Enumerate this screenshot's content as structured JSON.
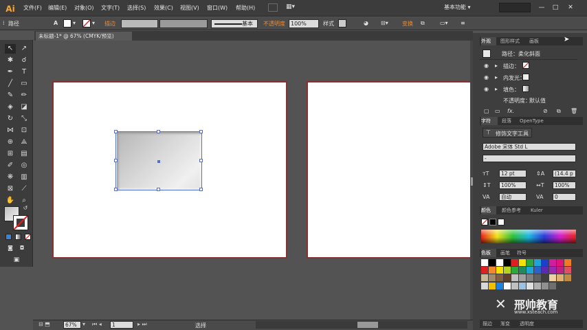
{
  "app": {
    "logo": "Ai"
  },
  "menu": [
    "文件(F)",
    "编辑(E)",
    "对象(O)",
    "文字(T)",
    "选择(S)",
    "效果(C)",
    "视图(V)",
    "窗口(W)",
    "帮助(H)"
  ],
  "workspace_label": "基本功能 ▾",
  "window_controls": [
    "—",
    "□",
    "✕"
  ],
  "control_bar": {
    "path_label": "路径",
    "stroke_label": "描边",
    "brush_label": "基本",
    "opacity_label": "不透明度",
    "opacity_value": "100%",
    "style_label": "样式",
    "transform_label": "变换"
  },
  "document_tab": "未标题-1* @ 67% (CMYK/预览)",
  "appearance_panel": {
    "tabs": [
      "外观",
      "图形样式",
      "画板"
    ],
    "title": "路径：柔化斜面",
    "rows": [
      {
        "label": "描边：",
        "orange": true
      },
      {
        "label": "内发光：",
        "orange": false
      },
      {
        "label": "填色：",
        "orange": false
      }
    ],
    "opacity_row": {
      "label": "不透明度：",
      "value": "默认值"
    },
    "footer_fx": "fx."
  },
  "char_panel": {
    "tabs": [
      "字符",
      "段落",
      "OpenType"
    ],
    "touch_tool": "修饰文字工具",
    "font_name": "Adobe 宋体 Std L",
    "font_style": "-",
    "size": "12 pt",
    "leading": "(14.4 p",
    "vscale": "100%",
    "hscale": "100%",
    "kerning": "自动",
    "tracking": "0"
  },
  "color_panel": {
    "tabs": [
      "颜色",
      "颜色参考",
      "Kuler"
    ]
  },
  "swatch_panel": {
    "tabs": [
      "色板",
      "画笔",
      "符号"
    ]
  },
  "bottom_panel_tabs": [
    "描边",
    "渐变",
    "透明度"
  ],
  "status": {
    "zoom": "67%",
    "page": "1",
    "mode": "选择"
  },
  "watermark": {
    "title": "邢帅教育",
    "url": "www.xsteach.com"
  },
  "colors": {
    "accent_orange": "#f08a2c",
    "artboard_border": "#8a2f33",
    "selection_blue": "#4f6fd6"
  },
  "icons": [
    "selection-arrow-icon",
    "direct-select-icon",
    "magic-wand-icon",
    "lasso-icon",
    "pen-icon",
    "type-icon",
    "line-icon",
    "rectangle-icon",
    "paintbrush-icon",
    "pencil-icon",
    "eraser-icon",
    "rotate-icon",
    "scale-icon",
    "width-icon",
    "free-transform-icon",
    "shape-builder-icon",
    "perspective-icon",
    "mesh-icon",
    "gradient-icon",
    "eyedropper-icon",
    "blend-icon",
    "symbol-sprayer-icon",
    "graph-icon",
    "artboard-icon",
    "slice-icon",
    "hand-icon",
    "zoom-icon",
    "eye-icon",
    "trash-icon"
  ]
}
